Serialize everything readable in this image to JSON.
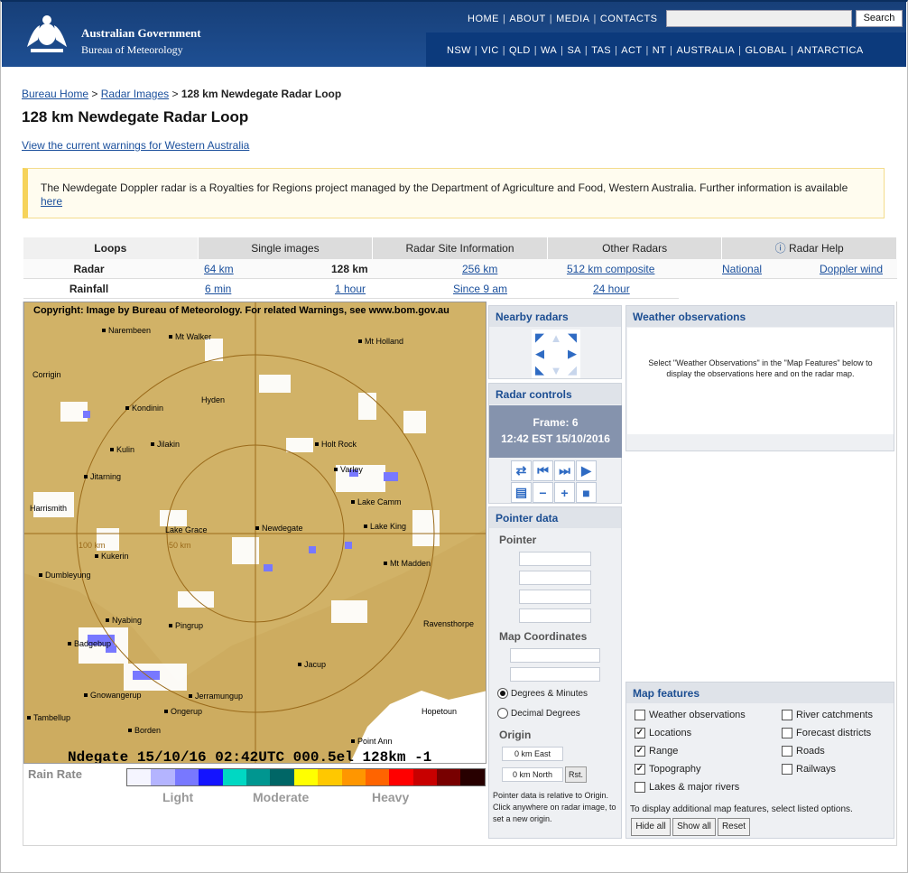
{
  "header": {
    "gov_line1": "Australian Government",
    "gov_line2": "Bureau of Meteorology",
    "top_nav": [
      "HOME",
      "ABOUT",
      "MEDIA",
      "CONTACTS"
    ],
    "search_button": "Search",
    "search_placeholder": "",
    "region_nav": [
      "NSW",
      "VIC",
      "QLD",
      "WA",
      "SA",
      "TAS",
      "ACT",
      "NT",
      "AUSTRALIA",
      "GLOBAL",
      "ANTARCTICA"
    ]
  },
  "breadcrumb": {
    "home": "Bureau Home",
    "radar": "Radar Images",
    "current": "128 km Newdegate Radar Loop",
    "sep": ">"
  },
  "page_title": "128 km Newdegate Radar Loop",
  "warning_link": "View the current warnings for Western Australia",
  "notice": {
    "text": "The Newdegate Doppler radar is a Royalties for Regions project managed by the Department of Agriculture and Food, Western Australia. Further information is available",
    "link": "here"
  },
  "tabs": [
    "Loops",
    "Single images",
    "Radar Site Information",
    "Other Radars",
    "Radar Help"
  ],
  "rows": {
    "radar": {
      "label": "Radar",
      "r64": "64 km",
      "r128": "128 km",
      "r256": "256 km",
      "r512": "512 km composite",
      "national": "National",
      "doppler": "Doppler wind"
    },
    "rainfall": {
      "label": "Rainfall",
      "six": "6 min",
      "hour": "1 hour",
      "since9": "Since 9 am",
      "day": "24 hour"
    }
  },
  "radar_image": {
    "copyright": "Copyright: Image by Bureau of Meteorology. For related Warnings, see www.bom.gov.au",
    "stamp": "Ndegate 15/10/16 02:42UTC 000.5el 128km -1",
    "range_100": "100 km",
    "range_50": "50 km",
    "towns": {
      "narembeen": "Narembeen",
      "mt_walker": "Mt Walker",
      "mt_holland": "Mt Holland",
      "corrigin": "Corrigin",
      "hyden": "Hyden",
      "kondinin": "Kondinin",
      "jilakin": "Jilakin",
      "kulin": "Kulin",
      "holt_rock": "Holt Rock",
      "varley": "Varley",
      "jitarning": "Jitarning",
      "lake_camm": "Lake Camm",
      "harrismith": "Harrismith",
      "lake_grace": "Lake Grace",
      "newdegate": "Newdegate",
      "lake_king": "Lake King",
      "kukerin": "Kukerin",
      "mt_madden": "Mt Madden",
      "dumbleyung": "Dumbleyung",
      "nyabing": "Nyabing",
      "pingrup": "Pingrup",
      "ravensthorpe": "Ravensthorpe",
      "badgebup": "Badgebup",
      "jacup": "Jacup",
      "gnowangerup": "Gnowangerup",
      "jerramungup": "Jerramungup",
      "ongerup": "Ongerup",
      "hopetoun": "Hopetoun",
      "tambellup": "Tambellup",
      "borden": "Borden",
      "point_ann": "Point Ann"
    }
  },
  "rain_rate": {
    "title": "Rain Rate",
    "light": "Light",
    "moderate": "Moderate",
    "heavy": "Heavy",
    "colors": [
      "#f5f5ff",
      "#b4b4ff",
      "#7878ff",
      "#1414ff",
      "#00d8c3",
      "#009690",
      "#006666",
      "#ffff00",
      "#ffc800",
      "#ff9600",
      "#ff6400",
      "#ff0000",
      "#c80000",
      "#780000",
      "#280000"
    ]
  },
  "nearby": {
    "title": "Nearby radars"
  },
  "controls": {
    "title": "Radar controls",
    "frame": "Frame: 6",
    "time": "12:42 EST 15/10/2016"
  },
  "pointer": {
    "title": "Pointer data",
    "pointer_label": "Pointer",
    "map_coords": "Map Coordinates",
    "deg_min": "Degrees & Minutes",
    "dec_deg": "Decimal Degrees",
    "origin": "Origin",
    "east": "0 km East",
    "north": "0 km North",
    "rst": "Rst.",
    "note": "Pointer data is relative to Origin. Click anywhere on radar image, to set a new origin."
  },
  "observations": {
    "title": "Weather observations",
    "body": "Select \"Weather Observations\" in the \"Map Features\" below to display the observations here and on the radar map."
  },
  "features": {
    "title": "Map features",
    "items": {
      "weather_obs": "Weather observations",
      "locations": "Locations",
      "range": "Range",
      "topography": "Topography",
      "lakes": "Lakes & major rivers",
      "river": "River catchments",
      "forecast": "Forecast districts",
      "roads": "Roads",
      "railways": "Railways"
    },
    "note": "To display additional map features, select listed options.",
    "hide": "Hide all",
    "show": "Show all",
    "reset": "Reset"
  },
  "colors": {
    "brand": "#1e4f93",
    "link": "#1a4f9c",
    "panel_head": "#1c4e92",
    "radar_land": "#d1b267",
    "ocean": "#ffffff"
  }
}
